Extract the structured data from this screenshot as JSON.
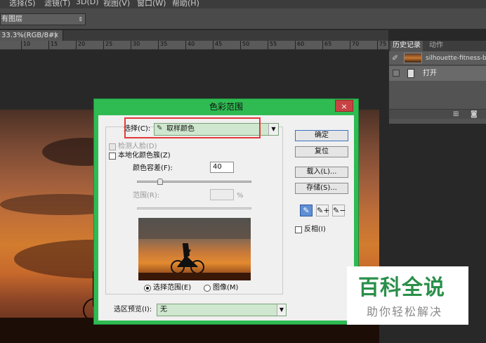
{
  "menu": [
    "选择(S)",
    "滤镜(T)",
    "3D(D)",
    "视图(V)",
    "窗口(W)",
    "帮助(H)"
  ],
  "options_bar": {
    "layer_select": "有图层"
  },
  "document": {
    "tab": "33.3%(RGB/8#)",
    "close": "×"
  },
  "ruler": {
    "ticks": [
      "10",
      "15",
      "20",
      "25",
      "30",
      "35",
      "40",
      "45",
      "50",
      "55",
      "60",
      "65",
      "70",
      "75"
    ]
  },
  "history_panel": {
    "tabs": [
      "历史记录",
      "动作"
    ],
    "snapshot_name": "silhouette-fitness-bl",
    "open_step": "打开",
    "icons": [
      "new-snapshot-icon",
      "camera-icon"
    ]
  },
  "dialog": {
    "title": "色彩范围",
    "close": "×",
    "select_label": "选择(C):",
    "select_value": "取样颜色",
    "detect_faces": "检测人脸(D)",
    "localized_clusters": "本地化颜色簇(Z)",
    "fuzziness_label": "颜色容差(F):",
    "fuzziness_value": "40",
    "fuzziness_level": 0.2,
    "range_label": "范围(R):",
    "range_value": "",
    "range_unit": "%",
    "radio_selection": "选择范围(E)",
    "radio_image": "图像(M)",
    "selection_preview_label": "选区预览(I):",
    "selection_preview_value": "无",
    "buttons": {
      "ok": "确定",
      "reset": "复位",
      "load": "载入(L)...",
      "save": "存储(S)..."
    },
    "invert": "反相(I)"
  },
  "watermark": {
    "title": "百科全说",
    "subtitle": "助你轻松解决"
  },
  "colors": {
    "dialog_frame": "#2fbb52",
    "highlight": "#e33a3a",
    "watermark_green": "#2a8f4a"
  }
}
